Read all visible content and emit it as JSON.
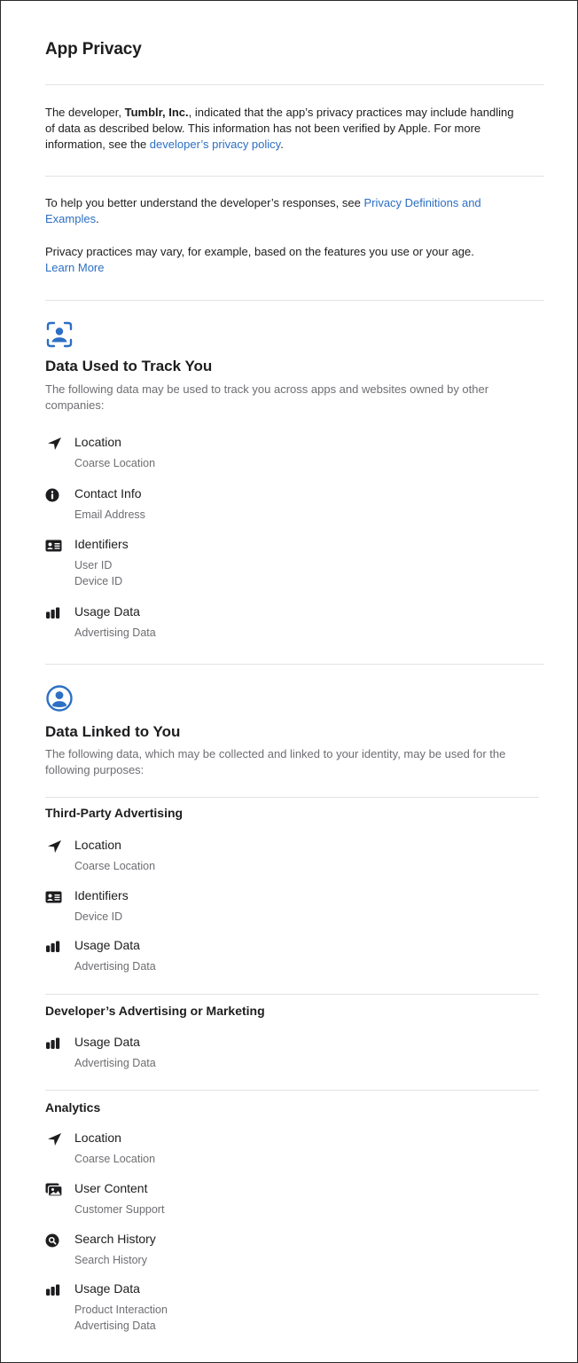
{
  "page": {
    "title": "App Privacy",
    "intro": {
      "text_before": "The developer, ",
      "developer_name": "Tumblr, Inc.",
      "text_line1_rest": ", indicated that the app’s privacy practices may include handling",
      "text_line2": "of data as described below. This information has not been verified by Apple. For more",
      "text_line3_before": "information, see the ",
      "privacy_policy_link": "developer’s privacy policy",
      "text_line3_after": "."
    },
    "definitions": {
      "text_before": "To help you better understand the developer’s responses, see ",
      "link_part1": "Privacy Definitions and",
      "link_part2": "Examples",
      "text_after": "."
    },
    "vary": {
      "text": "Privacy practices may vary, for example, based on the features you use or your age.",
      "learn_more": "Learn More"
    }
  },
  "colors": {
    "accent": "#2c6fc4",
    "text": "#1d1d1f",
    "secondary": "#6e6e73",
    "divider": "#e3e3e6"
  },
  "tracking": {
    "icon": "tracking-face-scan-icon",
    "title": "Data Used to Track You",
    "desc_line1": "The following data may be used to track you across apps and websites owned by other",
    "desc_line2": "companies:",
    "items": [
      {
        "icon": "location-arrow-icon",
        "label": "Location",
        "details": [
          "Coarse Location"
        ]
      },
      {
        "icon": "info-circle-icon",
        "label": "Contact Info",
        "details": [
          "Email Address"
        ]
      },
      {
        "icon": "id-card-icon",
        "label": "Identifiers",
        "details": [
          "User ID",
          "Device ID"
        ]
      },
      {
        "icon": "bar-chart-icon",
        "label": "Usage Data",
        "details": [
          "Advertising Data"
        ]
      }
    ]
  },
  "linked": {
    "icon": "person-circle-icon",
    "title": "Data Linked to You",
    "desc_line1": "The following data, which may be collected and linked to your identity, may be used for the",
    "desc_line2": "following purposes:",
    "purposes": [
      {
        "title": "Third-Party Advertising",
        "items": [
          {
            "icon": "location-arrow-icon",
            "label": "Location",
            "details": [
              "Coarse Location"
            ]
          },
          {
            "icon": "id-card-icon",
            "label": "Identifiers",
            "details": [
              "Device ID"
            ]
          },
          {
            "icon": "bar-chart-icon",
            "label": "Usage Data",
            "details": [
              "Advertising Data"
            ]
          }
        ]
      },
      {
        "title": "Developer’s Advertising or Marketing",
        "items": [
          {
            "icon": "bar-chart-icon",
            "label": "Usage Data",
            "details": [
              "Advertising Data"
            ]
          }
        ]
      },
      {
        "title": "Analytics",
        "items": [
          {
            "icon": "location-arrow-icon",
            "label": "Location",
            "details": [
              "Coarse Location"
            ]
          },
          {
            "icon": "photos-icon",
            "label": "User Content",
            "details": [
              "Customer Support"
            ]
          },
          {
            "icon": "search-circle-icon",
            "label": "Search History",
            "details": [
              "Search History"
            ]
          },
          {
            "icon": "bar-chart-icon",
            "label": "Usage Data",
            "details": [
              "Product Interaction",
              "Advertising Data"
            ]
          }
        ]
      }
    ]
  }
}
